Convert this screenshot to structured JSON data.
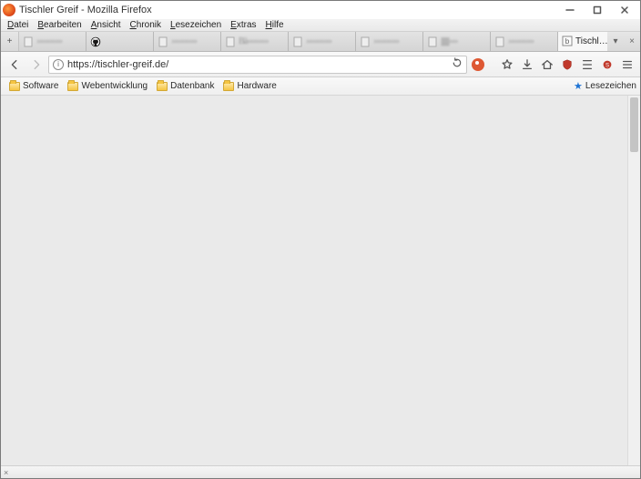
{
  "window": {
    "title": "Tischler Greif - Mozilla Firefox"
  },
  "menu": {
    "items": [
      "Datei",
      "Bearbeiten",
      "Ansicht",
      "Chronik",
      "Lesezeichen",
      "Extras",
      "Hilfe"
    ]
  },
  "tabs": {
    "new_tab_tooltip": "+",
    "items": [
      {
        "label": "››››››››››››",
        "blurred": true
      },
      {
        "label": "",
        "icon": "github"
      },
      {
        "label": "››››››››››››",
        "blurred": true
      },
      {
        "label": "Bä››››››››››",
        "blurred": true
      },
      {
        "label": "››››››››››››",
        "blurred": true
      },
      {
        "label": "››››››››››››",
        "blurred": true
      },
      {
        "label": "|||||||||››››",
        "blurred": true
      },
      {
        "label": "››››››››››››",
        "blurred": true
      },
      {
        "label": "Tischler Greif",
        "active": true
      }
    ],
    "overflow": "▾"
  },
  "nav": {
    "url": "https://tischler-greif.de/",
    "search_engine": "DuckDuckGo"
  },
  "toolbar_icons": {
    "download": "download-icon",
    "home": "home-icon",
    "shield": "shield-icon",
    "menu": "menu-icon",
    "addon": "addon-icon",
    "library": "library-icon",
    "bookmark_star": "bookmark-star-icon"
  },
  "bookmarks_bar": {
    "items": [
      "Software",
      "Webentwicklung",
      "Datenbank",
      "Hardware"
    ],
    "side_label": "Lesezeichen"
  },
  "statusbar": {
    "close": "×"
  }
}
